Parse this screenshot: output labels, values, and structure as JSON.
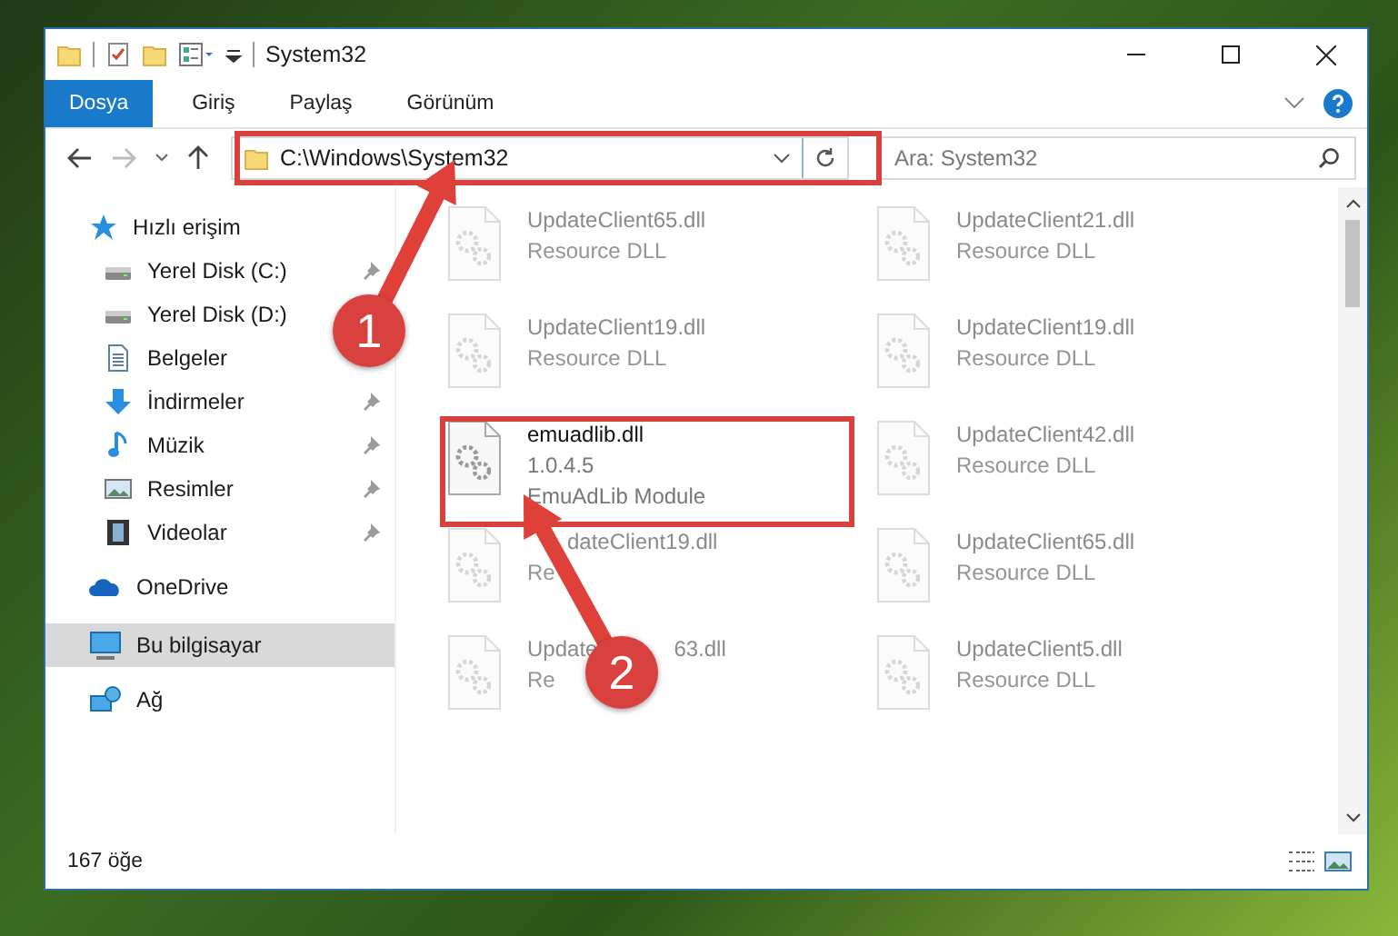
{
  "window": {
    "title": "System32"
  },
  "ribbon_tabs": [
    {
      "label": "Dosya",
      "selected": true
    },
    {
      "label": "Giriş",
      "selected": false
    },
    {
      "label": "Paylaş",
      "selected": false
    },
    {
      "label": "Görünüm",
      "selected": false
    }
  ],
  "address": {
    "path": "C:\\Windows\\System32"
  },
  "search": {
    "placeholder": "Ara: System32"
  },
  "nav": [
    {
      "label": "Hızlı erişim",
      "kind": "star",
      "selected": false,
      "children": [
        {
          "label": "Yerel Disk (C:)",
          "kind": "drive",
          "selected": false,
          "pinned": true
        },
        {
          "label": "Yerel Disk (D:)",
          "kind": "drive",
          "selected": false
        },
        {
          "label": "Belgeler",
          "kind": "document",
          "selected": false
        },
        {
          "label": "İndirmeler",
          "kind": "download",
          "selected": false,
          "pinned": true
        },
        {
          "label": "Müzik",
          "kind": "music",
          "selected": false,
          "pinned": true
        },
        {
          "label": "Resimler",
          "kind": "picture",
          "selected": false,
          "pinned": true
        },
        {
          "label": "Videolar",
          "kind": "video",
          "selected": false,
          "pinned": true
        }
      ]
    },
    {
      "label": "OneDrive",
      "kind": "cloud",
      "selected": false
    },
    {
      "label": "Bu bilgisayar",
      "kind": "computer",
      "selected": true
    },
    {
      "label": "Ağ",
      "kind": "network",
      "selected": false
    }
  ],
  "files": [
    {
      "name": "UpdateClient65.dll",
      "details": [
        "Resource DLL"
      ],
      "dimmed": true
    },
    {
      "name": "UpdateClient21.dll",
      "details": [
        "Resource DLL"
      ],
      "dimmed": true
    },
    {
      "name": "UpdateClient19.dll",
      "details": [
        "Resource DLL"
      ],
      "dimmed": true
    },
    {
      "name": "UpdateClient19.dll",
      "details": [
        "Resource DLL"
      ],
      "dimmed": true
    },
    {
      "name": "emuadlib.dll",
      "details": [
        "1.0.4.5",
        "EmuAdLib Module"
      ],
      "dimmed": false
    },
    {
      "name": "UpdateClient42.dll",
      "details": [
        "Resource DLL"
      ],
      "dimmed": true
    },
    {
      "name": "dateClient19.dll",
      "lead_covered": true,
      "details": [
        "Re"
      ],
      "dimmed": true
    },
    {
      "name": "UpdateClient65.dll",
      "details": [
        "Resource DLL"
      ],
      "dimmed": true
    },
    {
      "name": "Update",
      "name_after_cover": "63.dll",
      "details": [
        "Re"
      ],
      "dimmed": true
    },
    {
      "name": "UpdateClient5.dll",
      "details": [
        "Resource DLL"
      ],
      "dimmed": true
    }
  ],
  "status_bar": {
    "item_count": "167 öğe"
  },
  "annotations": [
    {
      "number": "1"
    },
    {
      "number": "2"
    }
  ]
}
